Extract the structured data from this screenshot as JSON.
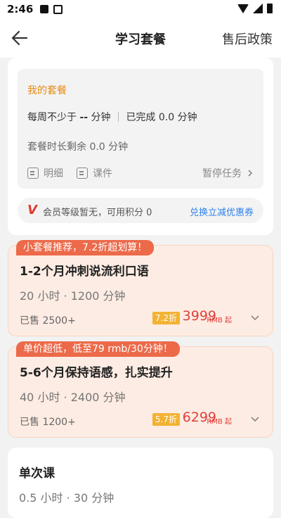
{
  "status_bar": {
    "time": "2:46",
    "icons": [
      "notification-square-icon",
      "photo-icon",
      "wifi-icon",
      "signal-icon",
      "battery-icon"
    ]
  },
  "header": {
    "title": "学习套餐",
    "action": "售后政策",
    "back_icon": "arrow-left-icon"
  },
  "my_package": {
    "title": "我的套餐",
    "weekly_prefix": "每周不少于",
    "weekly_value": "--",
    "weekly_unit": "分钟",
    "completed": "已完成 0.0 分钟",
    "remaining": "套餐时长剩余 0.0 分钟",
    "detail_label": "明细",
    "courseware_label": "课件",
    "pause_label": "暂停任务"
  },
  "member": {
    "icon": "V",
    "text": "会员等级暂无，可用积分 0",
    "link": "兑换立减优惠券"
  },
  "packages": [
    {
      "badge": "小套餐推荐，7.2折超划算！",
      "name": "1-2个月冲刺说流利口语",
      "hours": "20 小时 · 1200 分钟",
      "sold": "已售 2500+",
      "discount": "7.2折",
      "price": "3999",
      "unit": "RMB 起"
    },
    {
      "badge": "单价超低，低至79 rmb/30分钟！",
      "name": "5-6个月保持语感，扎实提升",
      "hours": "40 小时 · 2400 分钟",
      "sold": "已售 1200+",
      "discount": "5.7折",
      "price": "6299",
      "unit": "RMB 起"
    }
  ],
  "single": {
    "title": "单次课",
    "hours": "0.5 小时 · 30 分钟"
  },
  "colors": {
    "accent_orange": "#e48a12",
    "price_red": "#e0403a",
    "badge_red": "#ec6a4a",
    "link_blue": "#2f80ed",
    "card_peach": "#fdece3"
  }
}
